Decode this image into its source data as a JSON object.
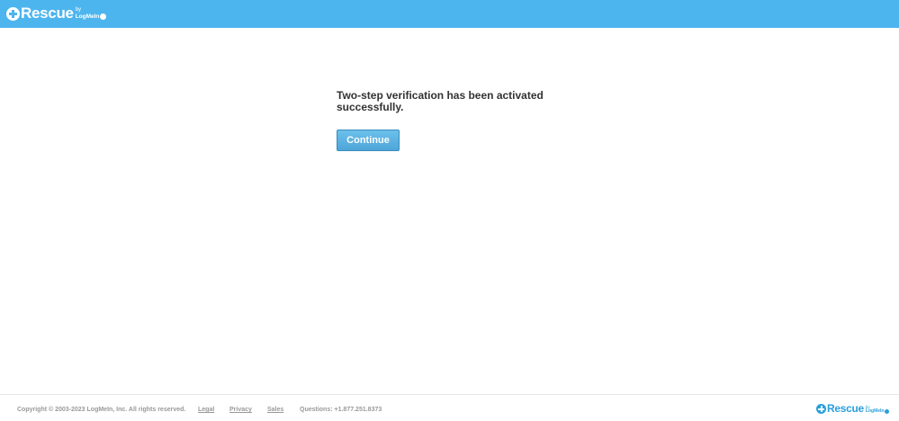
{
  "header": {
    "logo": {
      "wordmark": "Rescue",
      "by": "by",
      "brand": "LogMeIn"
    }
  },
  "main": {
    "message": "Two-step verification has been activated successfully.",
    "continue_label": "Continue"
  },
  "footer": {
    "copyright": "Copyright © 2003-2023 LogMeIn, Inc. All rights reserved.",
    "links": {
      "legal": "Legal",
      "privacy": "Privacy",
      "sales": "Sales"
    },
    "questions": "Questions: +1.877.251.8373",
    "logo": {
      "wordmark": "Rescue",
      "by": "by",
      "brand": "LogMeIn"
    }
  },
  "colors": {
    "header_bg": "#4db5ee",
    "button_bg": "#5aaee0",
    "text": "#333333",
    "footer_text": "#999999"
  }
}
